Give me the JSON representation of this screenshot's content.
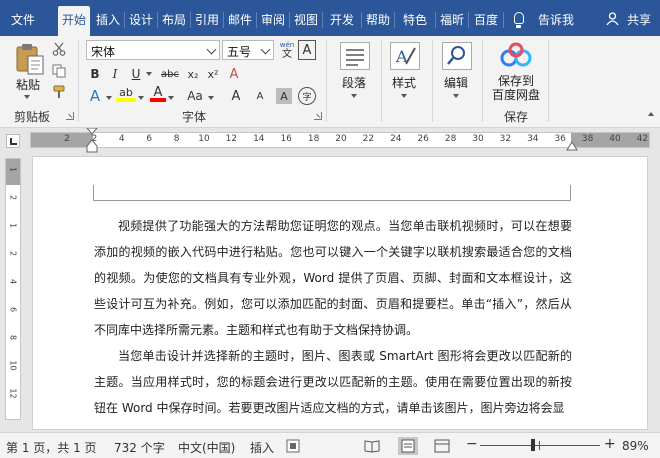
{
  "tabs": [
    "文件",
    "开始",
    "插入",
    "设计",
    "布局",
    "引用",
    "邮件",
    "审阅",
    "视图",
    "开发",
    "帮助",
    "特色",
    "福昕",
    "百度",
    "告诉我",
    "共享"
  ],
  "ribbon": {
    "clipboard": {
      "paste_label": "粘贴",
      "group_label": "剪贴板"
    },
    "font": {
      "font_name": "宋体",
      "font_size": "五号",
      "bold": "B",
      "italic": "I",
      "underline": "U",
      "strike": "abc",
      "subscript": "x₂",
      "superscript": "x²",
      "clear_format": "A",
      "text_effects": "A",
      "highlight": "ab",
      "font_color": "A",
      "change_case": "Aa",
      "grow": "A",
      "shrink": "A",
      "char_shading": "A",
      "enclose": "字",
      "wen_label": "wén",
      "group_label": "字体"
    },
    "paragraph": {
      "label": "段落"
    },
    "styles": {
      "label": "样式"
    },
    "editing": {
      "label": "编辑"
    },
    "save": {
      "label_line1": "保存到",
      "label_line2": "百度网盘",
      "group_label": "保存"
    }
  },
  "ruler": {
    "numbers": [
      "2",
      "2",
      "4",
      "6",
      "8",
      "10",
      "12",
      "14",
      "16",
      "18",
      "20",
      "22",
      "24",
      "26",
      "28",
      "30",
      "32",
      "34",
      "36",
      "38",
      "40",
      "42"
    ],
    "v_numbers": [
      "1",
      "2",
      "1",
      "2",
      "4",
      "6",
      "8",
      "10",
      "12"
    ]
  },
  "document": {
    "paragraphs": [
      "视频提供了功能强大的方法帮助您证明您的观点。当您单击联机视频时，可以在想要添加的视频的嵌入代码中进行粘贴。您也可以键入一个关键字以联机搜索最适合您的文档的视频。为使您的文档具有专业外观，Word 提供了页眉、页脚、封面和文本框设计，这些设计可互为补充。例如，您可以添加匹配的封面、页眉和提要栏。单击“插入”，然后从不同库中选择所需元素。主题和样式也有助于文档保持协调。",
      "当您单击设计并选择新的主题时，图片、图表或 SmartArt 图形将会更改以匹配新的主题。当应用样式时，您的标题会进行更改以匹配新的主题。使用在需要位置出现的新按钮在 Word 中保存时间。若要更改图片适应文档的方式，请单击该图片，图片旁边将会显"
    ]
  },
  "status": {
    "page": "第 1 页，共 1 页",
    "words": "732 个字",
    "language": "中文(中国)",
    "mode": "插入",
    "zoom_minus": "−",
    "zoom_plus": "+",
    "zoom": "89%",
    "zoom_level": 0.89
  },
  "colors": {
    "accent": "#2b579a",
    "highlight": "#ffff00",
    "font_color": "#ff0000"
  }
}
